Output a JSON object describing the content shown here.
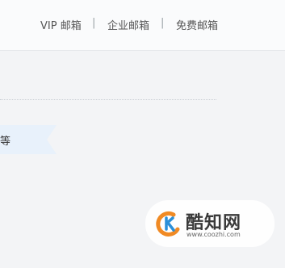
{
  "topnav": {
    "links": [
      {
        "label": "VIP 邮箱"
      },
      {
        "label": "企业邮箱"
      },
      {
        "label": "免费邮箱"
      }
    ],
    "separator": "|"
  },
  "ribbon": {
    "text": "等",
    "color": "#e8f1fb"
  },
  "watermark": {
    "name": "酷知网",
    "url": "www.coozhi.com",
    "logo_icon": "coozhi-logo-icon",
    "logo_colors": [
      "#f08a24",
      "#2b8fd8"
    ]
  },
  "colors": {
    "background": "#f3f4f6",
    "nav_text": "#555555"
  }
}
